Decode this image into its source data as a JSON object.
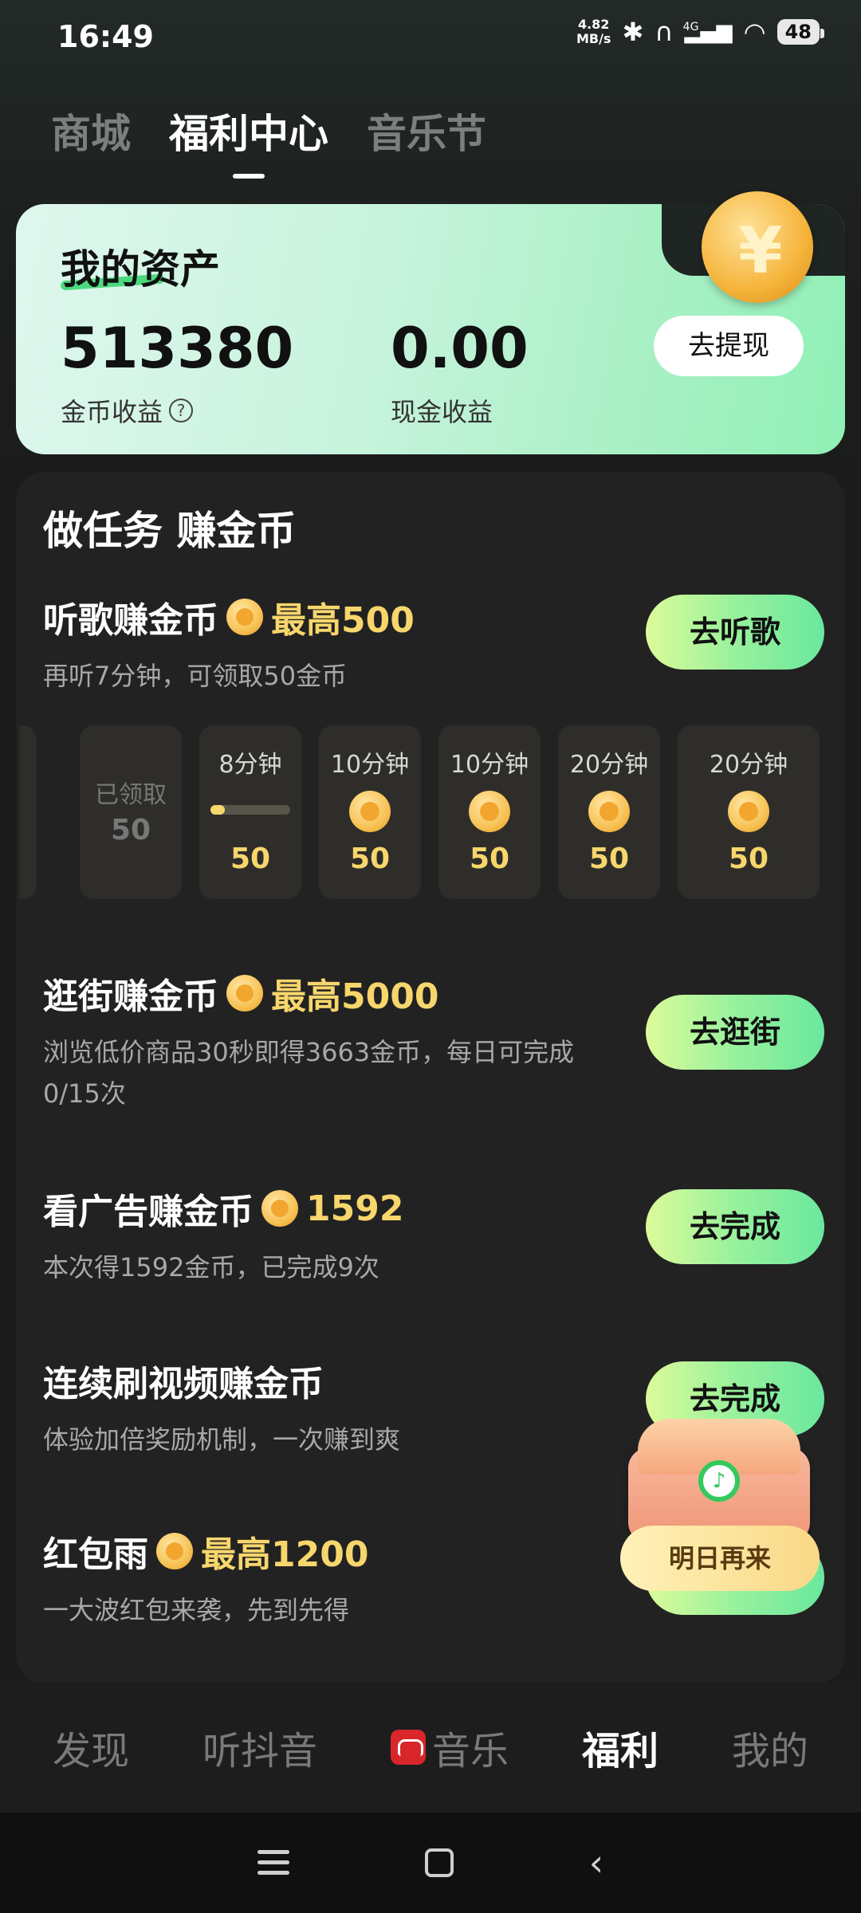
{
  "status_bar": {
    "time": "16:49",
    "net_speed_value": "4.82",
    "net_speed_unit": "MB/s",
    "signal_label": "4G",
    "battery": "48"
  },
  "top_tabs": [
    {
      "label": "商城",
      "active": false
    },
    {
      "label": "福利中心",
      "active": true
    },
    {
      "label": "音乐节",
      "active": false
    }
  ],
  "assets": {
    "title": "我的资产",
    "coin_balance": "513380",
    "coin_label": "金币收益",
    "cash_balance": "0.00",
    "cash_label": "现金收益",
    "withdraw_label": "去提现"
  },
  "tasks_title": "做任务 赚金币",
  "tasks": [
    {
      "title": "听歌赚金币",
      "reward": "最高500",
      "desc": "再听7分钟，可领取50金币",
      "button": "去听歌"
    },
    {
      "title": "逛街赚金币",
      "reward": "最高5000",
      "desc": "浏览低价商品30秒即得3663金币，每日可完成0/15次",
      "button": "去逛街"
    },
    {
      "title": "看广告赚金币",
      "reward": "1592",
      "desc": "本次得1592金币，已完成9次",
      "button": "去完成"
    },
    {
      "title": "连续刷视频赚金币",
      "reward": "",
      "desc": "体验加倍奖励机制，一次赚到爽",
      "button": "去完成"
    },
    {
      "title": "红包雨",
      "reward": "最高1200",
      "desc": "一大波红包来袭，先到先得",
      "button": ""
    }
  ],
  "listen_slots": {
    "claimed": {
      "label": "已领取",
      "value": "50"
    },
    "slots": [
      {
        "label": "8分钟",
        "value": "50",
        "progress": 0.18
      },
      {
        "label": "10分钟",
        "value": "50"
      },
      {
        "label": "10分钟",
        "value": "50"
      },
      {
        "label": "20分钟",
        "value": "50"
      },
      {
        "label": "20分钟",
        "value": "50"
      }
    ]
  },
  "chest": {
    "label": "明日再来"
  },
  "bottom_nav": [
    {
      "label": "发现",
      "active": false
    },
    {
      "label": "听抖音",
      "active": false
    },
    {
      "label": "音乐",
      "active": false
    },
    {
      "label": "福利",
      "active": true
    },
    {
      "label": "我的",
      "active": false
    }
  ],
  "colors": {
    "accent_green": "#6ae89e",
    "reward_gold": "#f7d66c",
    "brand_red": "#d8262b"
  }
}
